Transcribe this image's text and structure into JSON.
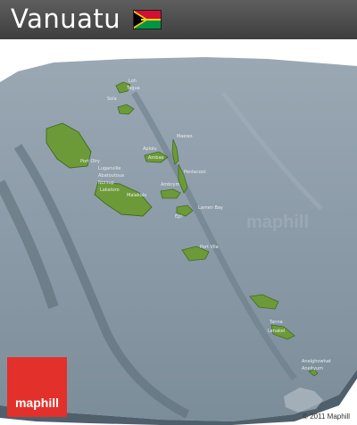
{
  "title": "Vanuatu",
  "flag": {
    "colors": [
      "#d21034",
      "#009543",
      "#000000",
      "#fdce12"
    ]
  },
  "map": {
    "style": "satellite panoramic 3D terrain, grey sea, green land",
    "colors": {
      "sea": "#8596a3",
      "sea_dark": "#5d6e7b",
      "land": "#6d9a38",
      "land_dark": "#3f6b22",
      "frame": "#ffffff"
    },
    "watermark": "maphill",
    "places": [
      "Loh",
      "Tegua",
      "Sola",
      "Port Olry",
      "Luganville",
      "Abatoutoua",
      "Norsup",
      "Lakatoro",
      "Malakula",
      "Aplolu",
      "Ambae",
      "Maewo",
      "Pentecost",
      "Ambrym",
      "Lamen Bay",
      "Epi",
      "Port Vila",
      "Tanna",
      "Lenakel",
      "Anelghowhat",
      "Aneityum"
    ]
  },
  "brand": {
    "name": "maphill"
  },
  "copyright": "© 2011 Maphill"
}
